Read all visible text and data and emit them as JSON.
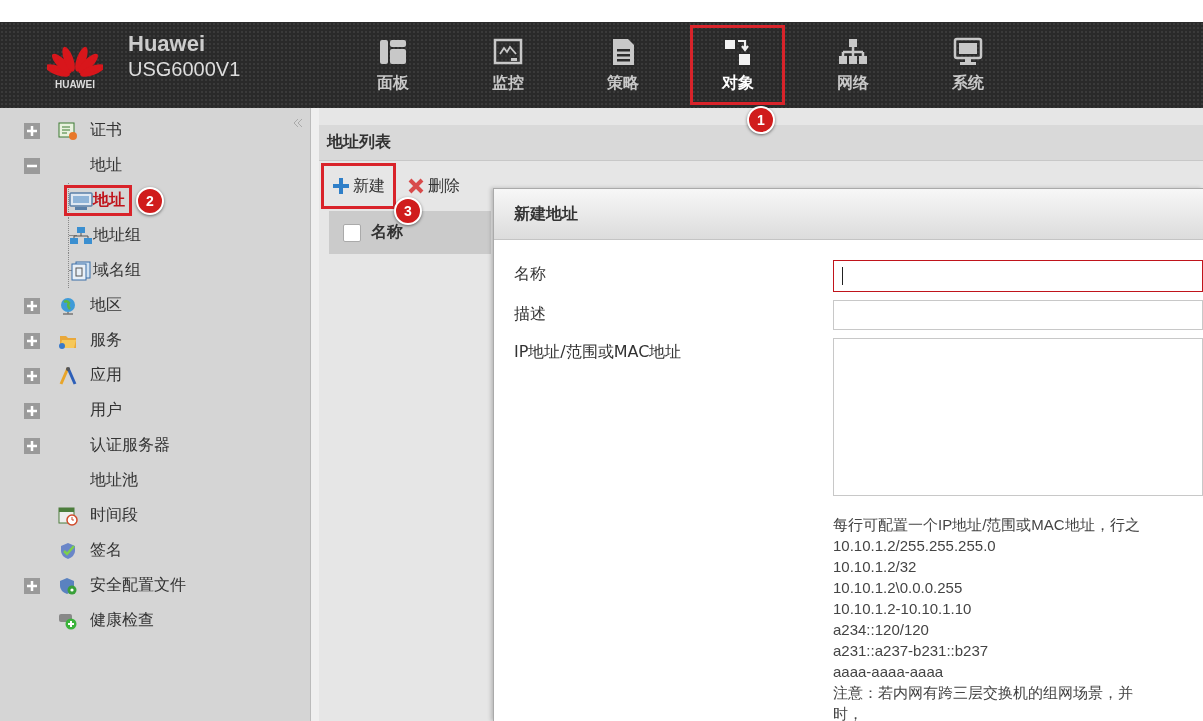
{
  "header": {
    "logo_text": "HUAWEI",
    "brand": "Huawei",
    "model": "USG6000V1"
  },
  "nav": [
    {
      "label": "面板",
      "selected": false
    },
    {
      "label": "监控",
      "selected": false
    },
    {
      "label": "策略",
      "selected": false
    },
    {
      "label": "对象",
      "selected": true,
      "callout": "1"
    },
    {
      "label": "网络",
      "selected": false
    },
    {
      "label": "系统",
      "selected": false
    }
  ],
  "sidebar": {
    "items": [
      {
        "label": "证书",
        "expanded": false,
        "selected": false
      },
      {
        "label": "地址",
        "expanded": true,
        "selected": false,
        "children": [
          {
            "label": "地址",
            "selected": true,
            "callout": "2"
          },
          {
            "label": "地址组",
            "selected": false
          },
          {
            "label": "域名组",
            "selected": false
          }
        ]
      },
      {
        "label": "地区",
        "expanded": false,
        "selected": false
      },
      {
        "label": "服务",
        "expanded": false,
        "selected": false
      },
      {
        "label": "应用",
        "expanded": false,
        "selected": false
      },
      {
        "label": "用户",
        "expanded": false,
        "selected": false
      },
      {
        "label": "认证服务器",
        "expanded": false,
        "selected": false
      },
      {
        "label": "地址池",
        "selected": false
      },
      {
        "label": "时间段",
        "selected": false
      },
      {
        "label": "签名",
        "selected": false
      },
      {
        "label": "安全配置文件",
        "expanded": false,
        "selected": false
      },
      {
        "label": "健康检查",
        "selected": false
      }
    ]
  },
  "panel": {
    "title": "地址列表",
    "toolbar": [
      {
        "label": "新建",
        "callout": "3"
      },
      {
        "label": "删除"
      }
    ],
    "table": {
      "select_all_checked": false,
      "columns": [
        {
          "label": "名称"
        }
      ]
    }
  },
  "dialog": {
    "title": "新建地址",
    "fields": [
      {
        "label": "名称",
        "kind": "input",
        "focused": true
      },
      {
        "label": "描述",
        "kind": "input",
        "focused": false
      },
      {
        "label": "IP地址/范围或MAC地址",
        "kind": "textarea",
        "focused": false
      }
    ],
    "hint_lines": [
      "每行可配置一个IP地址/范围或MAC地址，行之",
      "10.10.1.2/255.255.255.0",
      "10.10.1.2/32",
      "10.10.1.2\\0.0.0.255",
      "10.10.1.2-10.10.1.10",
      "a234::120/120",
      "a231::a237-b231::b237",
      "aaaa-aaaa-aaaa",
      "注意：若内网有跨三层交换机的组网场景，并",
      "时，"
    ]
  }
}
